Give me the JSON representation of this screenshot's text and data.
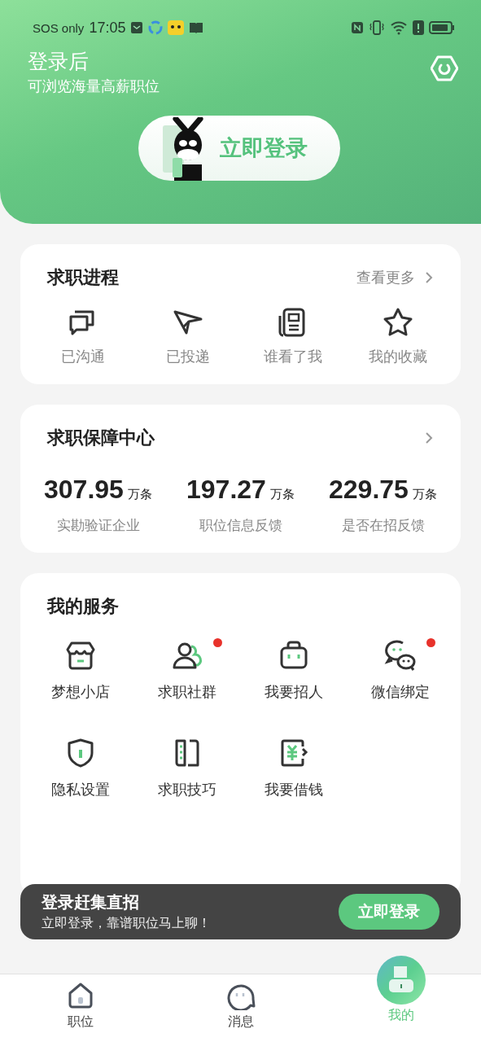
{
  "status_bar": {
    "carrier": "SOS only",
    "time": "17:05"
  },
  "header": {
    "title": "登录后",
    "subtitle": "可浏览海量高薪职位",
    "login_button": "立即登录"
  },
  "progress": {
    "title": "求职进程",
    "more": "查看更多",
    "items": [
      {
        "kind": "chat",
        "label": "已沟通"
      },
      {
        "kind": "send",
        "label": "已投递"
      },
      {
        "kind": "resume",
        "label": "谁看了我"
      },
      {
        "kind": "star",
        "label": "我的收藏"
      }
    ]
  },
  "guarantee": {
    "title": "求职保障中心",
    "stats": [
      {
        "value": "307.95",
        "unit": "万条",
        "label": "实勘验证企业"
      },
      {
        "value": "197.27",
        "unit": "万条",
        "label": "职位信息反馈"
      },
      {
        "value": "229.75",
        "unit": "万条",
        "label": "是否在招反馈"
      }
    ]
  },
  "services": {
    "title": "我的服务",
    "items": [
      {
        "kind": "shop",
        "label": "梦想小店",
        "badge": false
      },
      {
        "kind": "group",
        "label": "求职社群",
        "badge": true
      },
      {
        "kind": "bag",
        "label": "我要招人",
        "badge": false
      },
      {
        "kind": "wechat",
        "label": "微信绑定",
        "badge": true
      },
      {
        "kind": "shield",
        "label": "隐私设置",
        "badge": false
      },
      {
        "kind": "book",
        "label": "求职技巧",
        "badge": false
      },
      {
        "kind": "money",
        "label": "我要借钱",
        "badge": false
      }
    ]
  },
  "banner": {
    "title": "登录赶集直招",
    "text": "立即登录，靠谱职位马上聊！",
    "button": "立即登录"
  },
  "tabs": [
    {
      "kind": "home",
      "label": "职位",
      "selected": false
    },
    {
      "kind": "message",
      "label": "消息",
      "selected": false
    },
    {
      "kind": "me",
      "label": "我的",
      "selected": true
    }
  ]
}
